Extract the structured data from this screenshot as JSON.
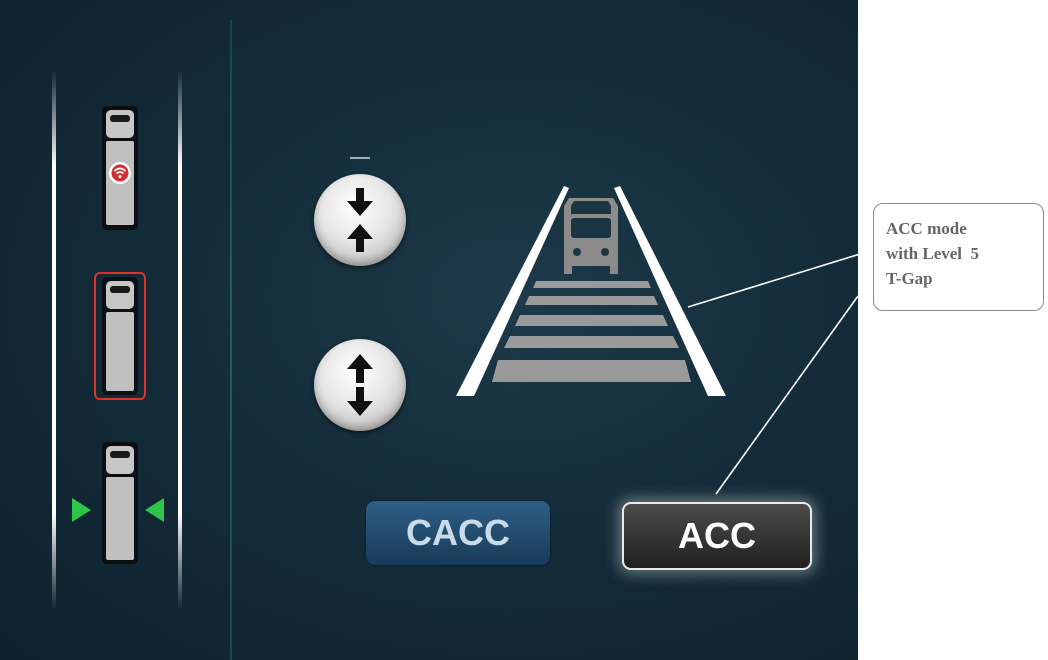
{
  "callout": {
    "line1": "ACC mode",
    "line2": "with Level  5",
    "line3": "T-Gap"
  },
  "buttons": {
    "cacc_label": "CACC",
    "acc_label": "ACC"
  },
  "gap_level": 5,
  "platoon": [
    {
      "name": "lead-vehicle",
      "badge": "wifi-connected-icon"
    },
    {
      "name": "ego-vehicle",
      "highlight": "#e0322b"
    },
    {
      "name": "following-vehicle",
      "side_markers": "green"
    }
  ],
  "colors": {
    "selected_mode": "#2a2a2a",
    "inactive_mode": "#1f4b6e",
    "lane_marker_green": "#2fc44a",
    "highlight_red": "#e0322b"
  }
}
